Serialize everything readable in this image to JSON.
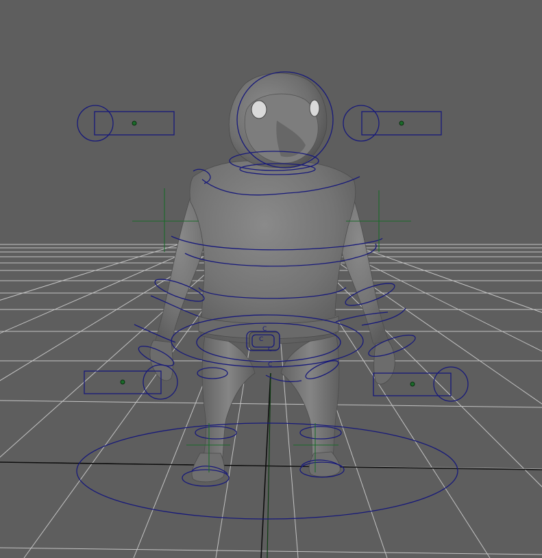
{
  "viewport": {
    "background": "#5e5e5e",
    "grid_color": "#d8d8d8",
    "axis_x_color": "#0d0d0d",
    "axis_z_color": "#0e3b12",
    "controller_color": "#16187a",
    "locator_color": "#1a6b2a",
    "mesh_color": "#7a7a7a"
  },
  "rig": {
    "pelvis_labels": [
      "C",
      "C",
      "C",
      "C"
    ]
  }
}
